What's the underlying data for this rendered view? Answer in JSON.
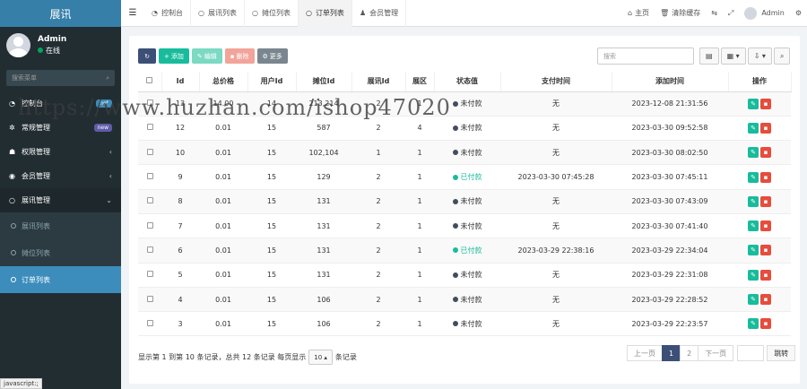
{
  "sidebar": {
    "brand": "展讯",
    "user": {
      "name": "Admin",
      "status": "在线"
    },
    "search_placeholder": "搜索菜单",
    "menu": [
      {
        "label": "控制台",
        "badge": "hot",
        "badge_color": "#3c8dbc"
      },
      {
        "label": "常规管理",
        "badge": "new",
        "badge_color": "#605ca8"
      },
      {
        "label": "权限管理",
        "arrow": "‹"
      },
      {
        "label": "会员管理",
        "arrow": "‹"
      },
      {
        "label": "展讯管理",
        "arrow": "⌄"
      }
    ],
    "submenu": [
      {
        "label": "展讯列表"
      },
      {
        "label": "摊位列表"
      },
      {
        "label": "订单列表"
      }
    ]
  },
  "status_hint": "javascript:;",
  "topbar": {
    "tabs": [
      {
        "label": "控制台"
      },
      {
        "label": "展讯列表"
      },
      {
        "label": "摊位列表"
      },
      {
        "label": "订单列表"
      },
      {
        "label": "会员管理"
      }
    ],
    "home": "主页",
    "clear_cache": "清除缓存",
    "admin": "Admin"
  },
  "toolbar": {
    "add": "添加",
    "edit": "编辑",
    "delete": "删除",
    "more": "更多",
    "search_placeholder": "搜索"
  },
  "table": {
    "headers": [
      "Id",
      "总价格",
      "用户Id",
      "摊位Id",
      "展讯Id",
      "展区",
      "状态值",
      "支付时间",
      "添加时间",
      "操作"
    ],
    "rows": [
      {
        "id": "13",
        "price": "14.00",
        "user": "14",
        "booth": "213,214",
        "expo": "2",
        "area": "1",
        "status": "未付款",
        "paid": false,
        "pay_time": "无",
        "add_time": "2023-12-08 21:31:56"
      },
      {
        "id": "12",
        "price": "0.01",
        "user": "15",
        "booth": "587",
        "expo": "2",
        "area": "4",
        "status": "未付款",
        "paid": false,
        "pay_time": "无",
        "add_time": "2023-03-30 09:52:58"
      },
      {
        "id": "10",
        "price": "0.01",
        "user": "15",
        "booth": "102,104",
        "expo": "1",
        "area": "1",
        "status": "未付款",
        "paid": false,
        "pay_time": "无",
        "add_time": "2023-03-30 08:02:50"
      },
      {
        "id": "9",
        "price": "0.01",
        "user": "15",
        "booth": "129",
        "expo": "2",
        "area": "1",
        "status": "已付款",
        "paid": true,
        "pay_time": "2023-03-30 07:45:28",
        "add_time": "2023-03-30 07:45:11"
      },
      {
        "id": "8",
        "price": "0.01",
        "user": "15",
        "booth": "131",
        "expo": "2",
        "area": "1",
        "status": "未付款",
        "paid": false,
        "pay_time": "无",
        "add_time": "2023-03-30 07:43:09"
      },
      {
        "id": "7",
        "price": "0.01",
        "user": "15",
        "booth": "131",
        "expo": "2",
        "area": "1",
        "status": "未付款",
        "paid": false,
        "pay_time": "无",
        "add_time": "2023-03-30 07:41:40"
      },
      {
        "id": "6",
        "price": "0.01",
        "user": "15",
        "booth": "131",
        "expo": "2",
        "area": "1",
        "status": "已付款",
        "paid": true,
        "pay_time": "2023-03-29 22:38:16",
        "add_time": "2023-03-29 22:34:04"
      },
      {
        "id": "5",
        "price": "0.01",
        "user": "15",
        "booth": "131",
        "expo": "2",
        "area": "1",
        "status": "未付款",
        "paid": false,
        "pay_time": "无",
        "add_time": "2023-03-29 22:31:08"
      },
      {
        "id": "4",
        "price": "0.01",
        "user": "15",
        "booth": "106",
        "expo": "2",
        "area": "1",
        "status": "未付款",
        "paid": false,
        "pay_time": "无",
        "add_time": "2023-03-29 22:28:52"
      },
      {
        "id": "3",
        "price": "0.01",
        "user": "15",
        "booth": "106",
        "expo": "2",
        "area": "1",
        "status": "未付款",
        "paid": false,
        "pay_time": "无",
        "add_time": "2023-03-29 22:23:57"
      }
    ]
  },
  "footer": {
    "summary": "显示第 1 到第 10 条记录，总共 12 条记录 每页显示",
    "page_size": "10",
    "suffix": "条记录",
    "prev": "上一页",
    "pages": [
      "1",
      "2"
    ],
    "current_page": "1",
    "next": "下一页",
    "go": "跳转"
  },
  "watermark": "https://www.huzhan.com/ishop47020",
  "colors": {
    "sidebar_bg": "#222d32",
    "brand_bg": "#367fa9",
    "active_blue": "#3c8dbc",
    "green": "#18bc9c",
    "red": "#e74c3c",
    "navy": "#3c4f76"
  }
}
